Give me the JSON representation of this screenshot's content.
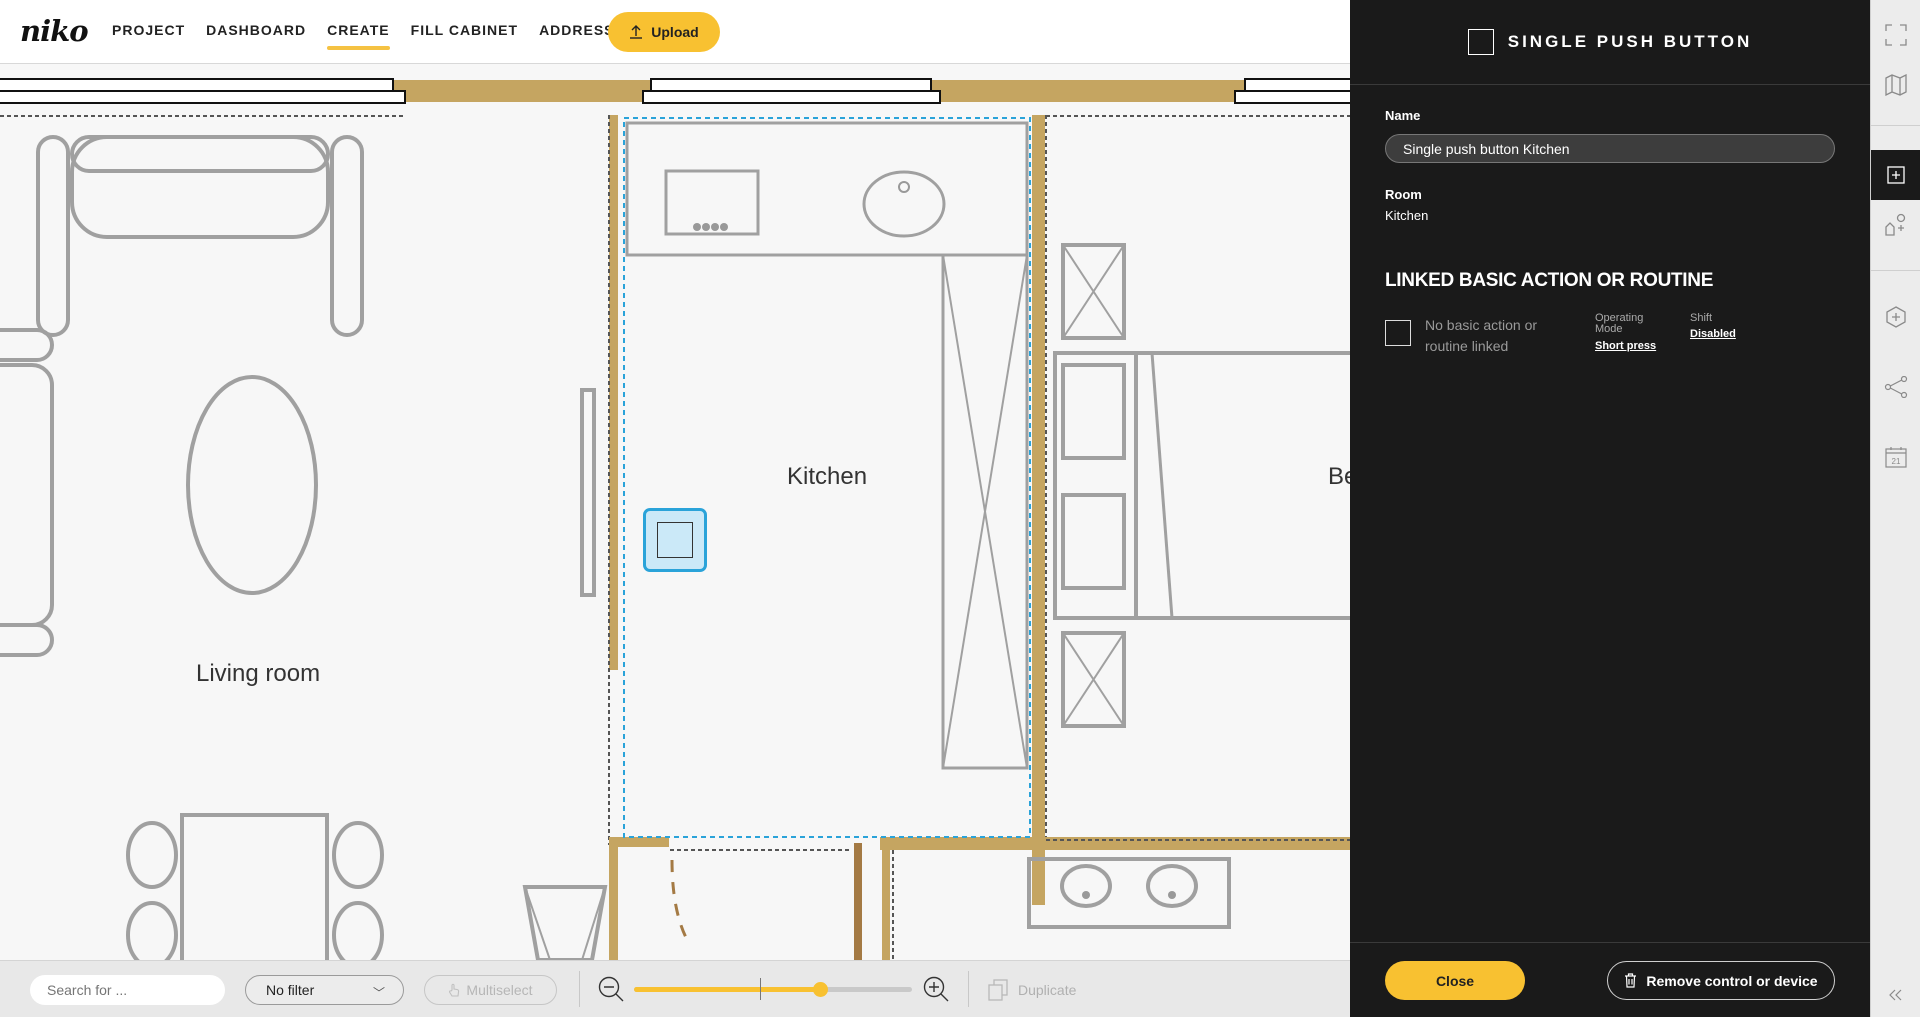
{
  "header": {
    "logo": "niko",
    "nav": [
      {
        "label": "PROJECT",
        "active": false
      },
      {
        "label": "DASHBOARD",
        "active": false
      },
      {
        "label": "CREATE",
        "active": true
      },
      {
        "label": "FILL CABINET",
        "active": false
      },
      {
        "label": "ADDRESS",
        "active": false
      }
    ],
    "upload_label": "Upload"
  },
  "floorplan": {
    "rooms": {
      "kitchen": "Kitchen",
      "living": "Living room",
      "bedroom_partial": "Be"
    },
    "selected_device_icon": "single-push-button-icon"
  },
  "toolbar": {
    "search_placeholder": "Search for ...",
    "filter_value": "No filter",
    "multiselect_label": "Multiselect",
    "duplicate_label": "Duplicate",
    "zoom_level": 0.67
  },
  "panel": {
    "title": "SINGLE PUSH BUTTON",
    "name_label": "Name",
    "name_value": "Single push button Kitchen",
    "room_label": "Room",
    "room_value": "Kitchen",
    "section_title": "LINKED BASIC ACTION OR ROUTINE",
    "no_link_text": "No basic action or routine linked",
    "operating_mode_label": "Operating Mode",
    "operating_mode_value": "Short press",
    "shift_label": "Shift",
    "shift_value": "Disabled",
    "close_label": "Close",
    "remove_label": "Remove control or device"
  },
  "rail": {
    "icons": [
      "fullscreen-icon",
      "map-icon",
      "add-icon",
      "add-shape-icon",
      "add-hexagon-icon",
      "share-node-icon",
      "calendar-icon",
      "collapse-icon"
    ]
  },
  "colors": {
    "accent": "#f8c131",
    "wall": "#c5a561",
    "selection": "#2aa3d9",
    "panel_bg": "#1a1a1a"
  }
}
